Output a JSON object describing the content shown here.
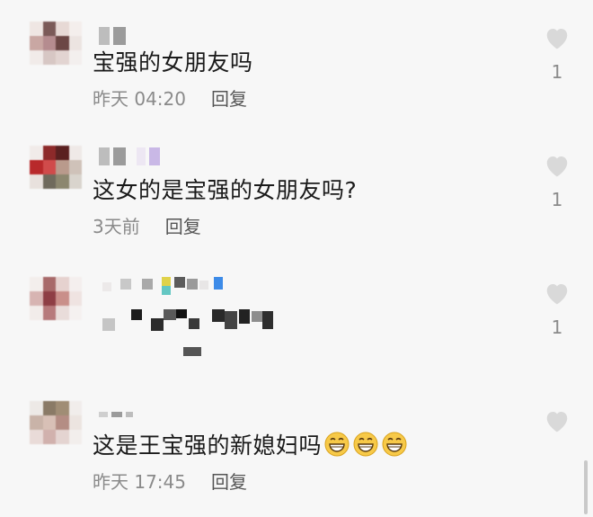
{
  "comments": [
    {
      "text": "宝强的女朋友吗",
      "time": "昨天 04:20",
      "reply": "回复",
      "likes": "1"
    },
    {
      "text": "这女的是宝强的女朋友吗?",
      "time": "3天前",
      "reply": "回复",
      "likes": "1"
    },
    {
      "text": "",
      "time": "",
      "reply": "",
      "likes": "1"
    },
    {
      "text": "这是王宝强的新媳妇吗",
      "time": "昨天 17:45",
      "reply": "回复",
      "likes": ""
    }
  ],
  "colors": {
    "background": "#f7f7f7",
    "text": "#1a1a1a",
    "meta": "#8a8a8a",
    "heart": "#d9d9d9",
    "emoji_face": "#f7c948"
  },
  "icons": {
    "like": "heart-icon",
    "emoji": "grinning-emoji-icon"
  }
}
